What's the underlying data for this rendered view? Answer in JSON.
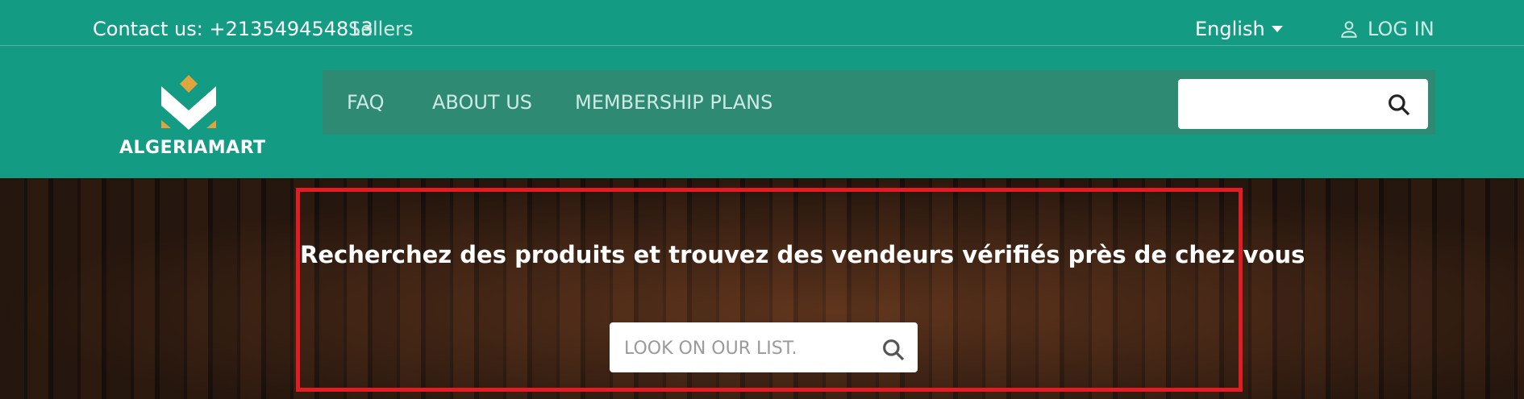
{
  "topbar": {
    "contact_label": "Contact us:",
    "phone": "+213549454813",
    "sellers_link": "Sellers",
    "language": "English",
    "login_label": "LOG IN"
  },
  "header": {
    "logo_text": "ALGERIAMART",
    "nav": {
      "faq": "FAQ",
      "about": "ABOUT US",
      "membership": "MEMBERSHIP PLANS"
    },
    "search_placeholder": ""
  },
  "hero": {
    "title": "Recherchez des produits et trouvez des vendeurs vérifiés près de chez vous",
    "search_placeholder": "LOOK ON OUR LIST."
  },
  "colors": {
    "brand_green": "#149b84",
    "nav_green": "#2f8a73",
    "logo_gold": "#e0a43c",
    "highlight_red": "#e11d23"
  }
}
